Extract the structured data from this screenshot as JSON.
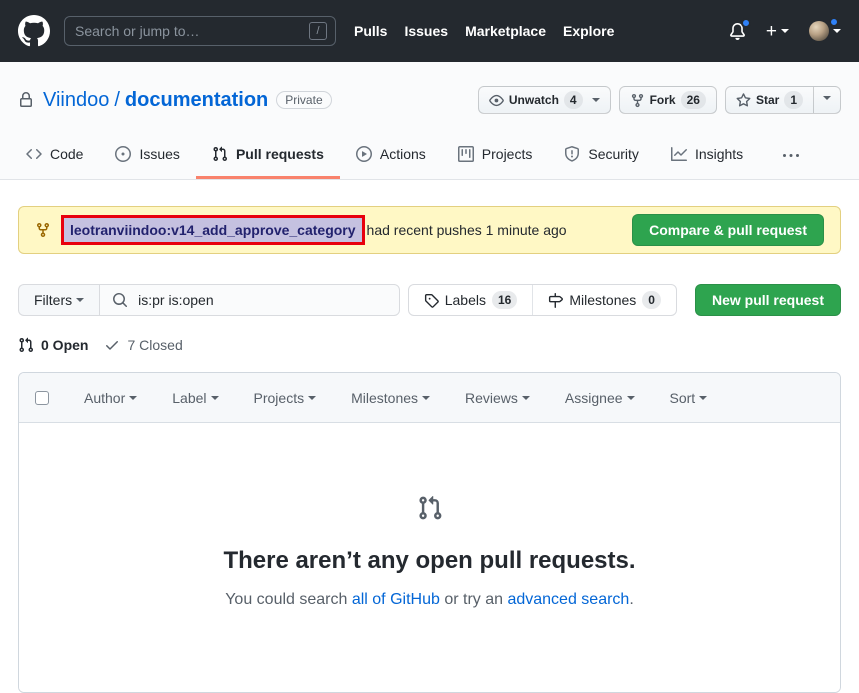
{
  "header": {
    "search": {
      "placeholder": "Search or jump to…",
      "shortcut": "/"
    },
    "nav": {
      "pulls": "Pulls",
      "issues": "Issues",
      "marketplace": "Marketplace",
      "explore": "Explore"
    },
    "plus": "+"
  },
  "repo": {
    "owner": "Viindoo",
    "separator": "/",
    "name": "documentation",
    "visibility": "Private",
    "unwatch_label": "Unwatch",
    "unwatch_count": "4",
    "fork_label": "Fork",
    "fork_count": "26",
    "star_label": "Star",
    "star_count": "1"
  },
  "tabs": {
    "code": "Code",
    "issues": "Issues",
    "pulls": "Pull requests",
    "actions": "Actions",
    "projects": "Projects",
    "security": "Security",
    "insights": "Insights"
  },
  "banner": {
    "branch": "leotranviindoo:v14_add_approve_category",
    "message": "had recent pushes 1 minute ago",
    "compare_button": "Compare & pull request"
  },
  "filter_bar": {
    "filters_button": "Filters",
    "search_value": "is:pr is:open",
    "labels_label": "Labels",
    "labels_count": "16",
    "milestones_label": "Milestones",
    "milestones_count": "0",
    "new_pr_button": "New pull request"
  },
  "issue_states": {
    "open": "0 Open",
    "closed": "7 Closed"
  },
  "list_filters": {
    "author": "Author",
    "label": "Label",
    "projects": "Projects",
    "milestones": "Milestones",
    "reviews": "Reviews",
    "assignee": "Assignee",
    "sort": "Sort"
  },
  "empty_state": {
    "title": "There aren’t any open pull requests.",
    "text_before": "You could search ",
    "link_all_github": "all of GitHub",
    "text_middle": " or try an ",
    "link_advanced": "advanced search",
    "text_after": "."
  },
  "colors": {
    "header_bg": "#24292f",
    "accent_green": "#2ea44f",
    "tab_underline": "#f9826c",
    "banner_bg": "#fff8c5",
    "branch_highlight_bg": "#c5c1e0",
    "annotation_red": "#e8000d",
    "link_blue": "#0366d6",
    "notification_blue": "#2f81f7"
  }
}
